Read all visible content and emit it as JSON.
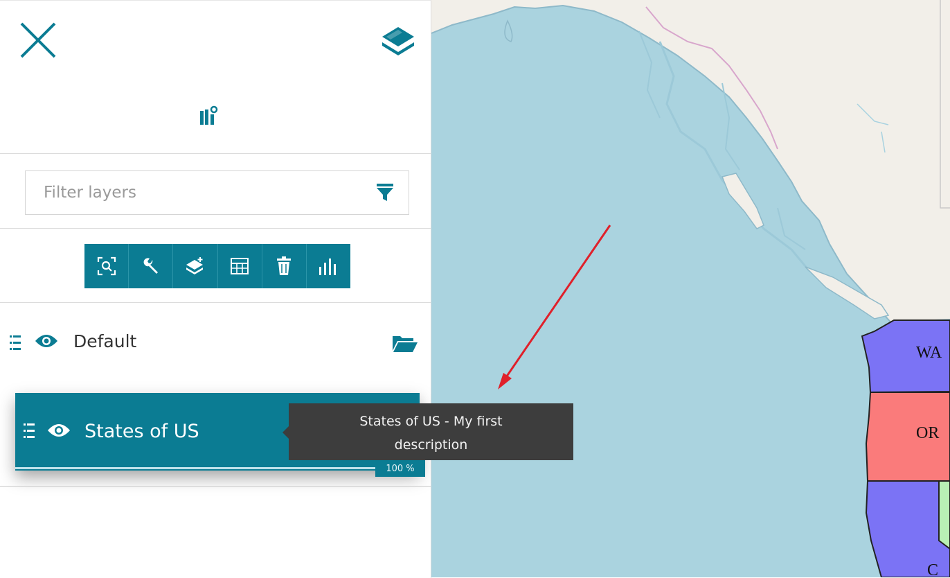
{
  "panel": {
    "filter": {
      "placeholder": "Filter layers",
      "value": ""
    },
    "toolbar": {
      "buttons": [
        "zoom-to-layer",
        "settings",
        "add-layer",
        "attribute-table",
        "delete",
        "chart"
      ]
    },
    "layers": [
      {
        "name": "Default",
        "type": "group",
        "visible": true
      },
      {
        "name": "States of US",
        "type": "layer",
        "visible": true,
        "selected": true,
        "opacity": "100 %"
      }
    ],
    "tooltip": "States of US - My first description"
  },
  "map": {
    "labels": [
      "WA",
      "OR",
      "C"
    ],
    "colors": {
      "sea": "#aad3df",
      "land": "#f2efe9",
      "wa": "#7b73f5",
      "or": "#fa7b7b",
      "ca": "#7b73f5",
      "nv": "#b9f0b5",
      "annotation_arrow": "#e0202a"
    }
  },
  "theme": {
    "accent": "#0b7c93"
  }
}
